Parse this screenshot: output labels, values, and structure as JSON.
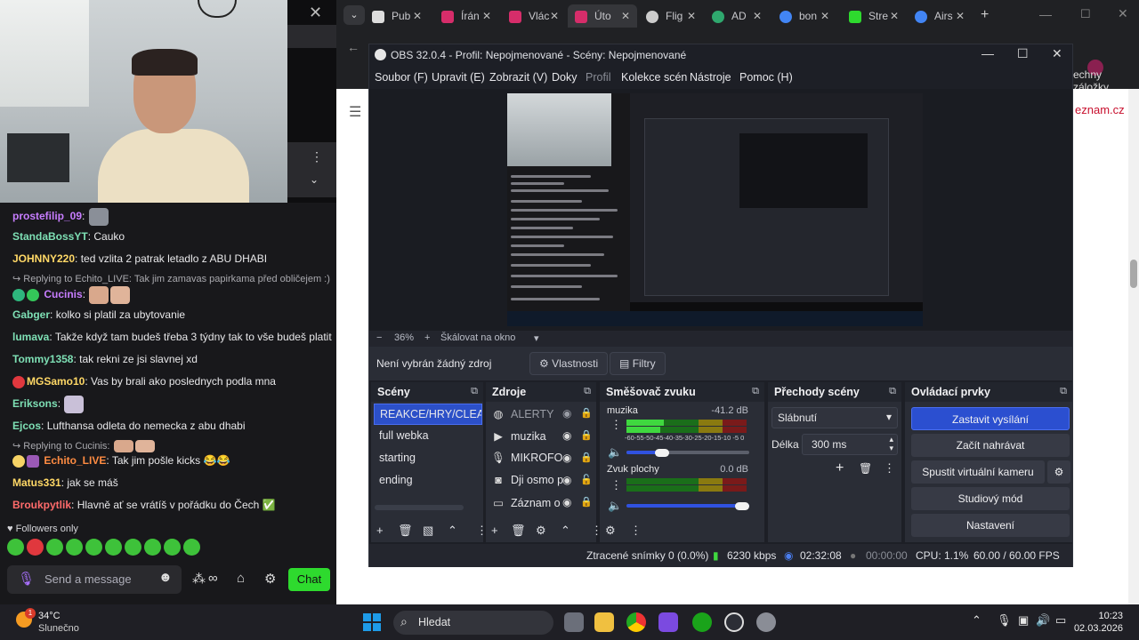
{
  "browser": {
    "tabs": [
      {
        "label": "Pub",
        "color": "#dddddd"
      },
      {
        "label": "Írán",
        "color": "#d62d6a"
      },
      {
        "label": "Vlác",
        "color": "#d62d6a"
      },
      {
        "label": "Úto",
        "color": "#d62d6a"
      },
      {
        "label": "Flig",
        "color": "#cccccc"
      },
      {
        "label": "AD",
        "color": "#2fa86e"
      },
      {
        "label": "bon",
        "color": "#4285f4"
      },
      {
        "label": "Stre",
        "color": "#2eda2e"
      },
      {
        "label": "Airs",
        "color": "#4285f4"
      }
    ],
    "bookmarks_label": "echny záložky",
    "page_brand": "eznam.cz"
  },
  "twitch": {
    "chat": [
      {
        "user": "prostefilip_09",
        "text": "",
        "color": "#c77dff"
      },
      {
        "user": "StandaBossYT",
        "text": "Cauko",
        "color": "#7ee0b5"
      },
      {
        "user": "JOHNNY220",
        "text": "ted vzlita 2 patrak letadlo z ABU DHABI",
        "color": "#ffd866"
      },
      {
        "reply": "Replying to Echito_LIVE: Tak jim zamavas papirkama před obličejem :)"
      },
      {
        "user": "Cucinis",
        "text": "",
        "color": "#c77dff"
      },
      {
        "user": "Gabger",
        "text": "kolko si platil za ubytovanie",
        "color": "#7ee0b5"
      },
      {
        "user": "lumava",
        "text": "Takže když tam budeš třeba 3 týdny tak to vše budeš platit",
        "color": "#7ee0b5"
      },
      {
        "user": "Tommy1358",
        "text": "tak rekni ze jsi slavnej xd",
        "color": "#7ee0b5"
      },
      {
        "user": "MGSamo10",
        "text": "Vas by brali ako poslednych podla mna",
        "color": "#ffd866"
      },
      {
        "user": "Eriksons",
        "text": "",
        "color": "#7ee0b5"
      },
      {
        "user": "Ejcos",
        "text": "Lufthansa odleta do nemecka z abu dhabi",
        "color": "#7ee0b5"
      },
      {
        "reply": "Replying to Cucinis:"
      },
      {
        "user": "Echito_LIVE",
        "text": "Tak jim pošle kicks 😂😂",
        "color": "#ff8c42"
      },
      {
        "user": "Matus331",
        "text": "jak se máš",
        "color": "#ffd866"
      },
      {
        "user": "Broukpytlik",
        "text": "Hlavně ať se vrátíš v pořádku do Čech ✅",
        "color": "#ff6b6b"
      }
    ],
    "followers_only": "Followers only",
    "send_placeholder": "Send a message",
    "chat_button": "Chat"
  },
  "obs": {
    "title": "OBS 32.0.4 - Profil: Nepojmenované - Scény: Nepojmenované",
    "menu": [
      "Soubor (F)",
      "Upravit (E)",
      "Zobrazit (V)",
      "Doky",
      "Profil",
      "Kolekce scén",
      "Nástroje",
      "Pomoc (H)"
    ],
    "zoom": "36%",
    "scale_mode": "Škálovat na okno",
    "no_source": "Není vybrán žádný zdroj",
    "properties_label": "Vlastnosti",
    "filters_label": "Filtry",
    "docks": {
      "scenes": "Scény",
      "sources": "Zdroje",
      "mixer": "Směšovač zvuku",
      "transitions": "Přechody scény",
      "controls": "Ovládací prvky"
    },
    "scenes": [
      "REAKCE/HRY/CLEANFEI",
      "full webka",
      "starting",
      "ending"
    ],
    "sources": [
      "ALERTY",
      "muzika",
      "MIKROFO",
      "Dji osmo p",
      "Záznam o"
    ],
    "mixer": [
      {
        "name": "muzika",
        "level": "-41.2 dB",
        "volume": 0.3
      },
      {
        "name": "Zvuk plochy",
        "level": "0.0 dB",
        "volume": 1.0
      }
    ],
    "meter_scale": "-60-55-50-45-40-35-30-25-20-15-10 -5  0",
    "transition": {
      "type": "Slábnutí",
      "duration_label": "Délka",
      "duration": "300 ms"
    },
    "controls": [
      "Zastavit vysílání",
      "Začít nahrávat",
      "Spustit virtuální kameru",
      "Studiový mód",
      "Nastavení"
    ],
    "status": {
      "dropped": "Ztracené snímky 0 (0.0%)",
      "bitrate": "6230 kbps",
      "stream_time": "02:32:08",
      "rec_time": "00:00:00",
      "cpu": "CPU: 1.1%",
      "fps": "60.00 / 60.00 FPS"
    }
  },
  "taskbar": {
    "temp": "34°C",
    "condition": "Slunečno",
    "weather_badge": "1",
    "search": "Hledat",
    "time": "10:23",
    "date": "02.03.2026"
  }
}
